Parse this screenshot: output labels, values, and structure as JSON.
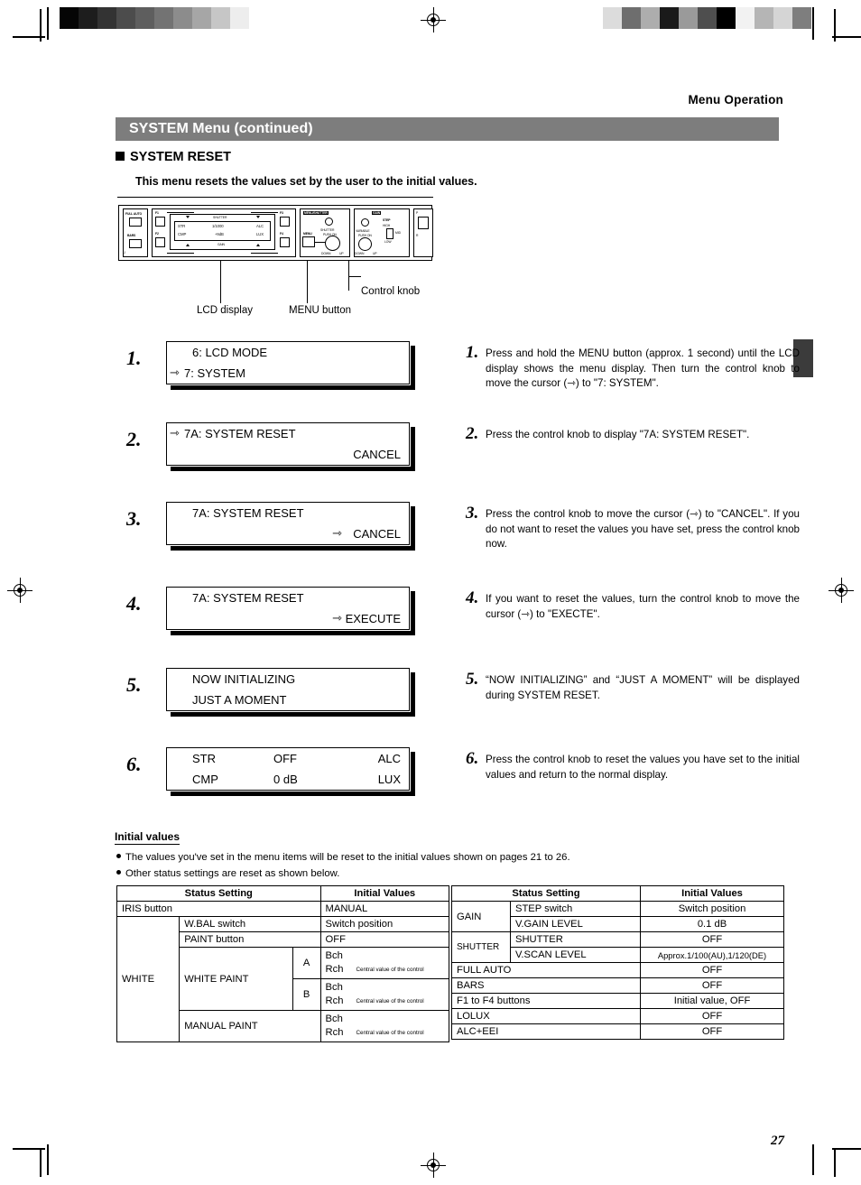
{
  "running_head": "Menu Operation",
  "title_bar": "SYSTEM Menu (continued)",
  "section_heading": "SYSTEM RESET",
  "section_subtitle": "This menu resets the values set by the user to the initial values.",
  "page_number": "27",
  "panel": {
    "buttons": {
      "full_auto": "FULL AUTO",
      "bars": "BARS",
      "f1": "F1",
      "f2": "F2",
      "f3": "F3",
      "f4": "F4",
      "menu": "MENU"
    },
    "lcd": {
      "top_label": "SHUTTER",
      "bottom_label": "GAIN",
      "row1": [
        "STR",
        "1/1000",
        "ALC"
      ],
      "row2": [
        "CMP",
        "+9dB",
        "LUX"
      ]
    },
    "menu_shutter_group": "MENU/SHUTTER",
    "gain_group": "GAIN",
    "shutter_label": "SHUTTER",
    "shutter_push_on": "PUSH ON",
    "variable_label": "VARIABLE",
    "variable_push_on": "PUSH ON",
    "step_label": "STEP",
    "step_high": "HIGH",
    "step_mid": "MID",
    "step_low": "LOW",
    "down": "DOWN",
    "up": "UP"
  },
  "callouts": {
    "lcd_display": "LCD display",
    "menu_button": "MENU button",
    "control_knob": "Control knob"
  },
  "steps": [
    {
      "num": "1.",
      "screen": {
        "row1": {
          "cursor": "",
          "left": "6: LCD MODE",
          "center": "",
          "right": ""
        },
        "row2": {
          "cursor": "⇾",
          "left": "7: SYSTEM",
          "center": "",
          "right": ""
        }
      },
      "instruction": "Press and hold the MENU button (approx. 1 second) until the LCD display shows the menu display. Then turn the control knob to move the cursor (⇾) to \"7: SYSTEM\"."
    },
    {
      "num": "2.",
      "screen": {
        "row1": {
          "cursor": "⇾",
          "left": "7A: SYSTEM RESET",
          "center": "",
          "right": ""
        },
        "row2": {
          "cursor": "",
          "left": "",
          "center": "",
          "right": "CANCEL"
        }
      },
      "instruction": "Press the control knob to display \"7A: SYSTEM RESET\"."
    },
    {
      "num": "3.",
      "screen": {
        "row1": {
          "cursor": "",
          "left": "7A: SYSTEM RESET",
          "center": "",
          "right": ""
        },
        "row2": {
          "cursor": "⇾",
          "left": "",
          "center": "",
          "right": "CANCEL"
        }
      },
      "instruction": "Press the control knob to move the cursor (⇾) to \"CANCEL\". If you do not want to reset the values you have set, press the control knob now."
    },
    {
      "num": "4.",
      "screen": {
        "row1": {
          "cursor": "",
          "left": "7A: SYSTEM RESET",
          "center": "",
          "right": ""
        },
        "row2": {
          "cursor": "⇾",
          "left": "",
          "center": "",
          "right": "EXECUTE"
        }
      },
      "instruction": "If you want to reset the values, turn the control knob to move the cursor (⇾) to \"EXECTE\"."
    },
    {
      "num": "5.",
      "screen": {
        "row1": {
          "cursor": "",
          "left": "NOW INITIALIZING",
          "center": "",
          "right": ""
        },
        "row2": {
          "cursor": "",
          "left": "JUST A MOMENT",
          "center": "",
          "right": ""
        }
      },
      "instruction": "“NOW INITIALIZING” and “JUST A MOMENT” will be displayed during SYSTEM RESET."
    },
    {
      "num": "6.",
      "screen": {
        "row1": {
          "cursor": "",
          "left": "STR",
          "center": "OFF",
          "right": "ALC"
        },
        "row2": {
          "cursor": "",
          "left": "CMP",
          "center": "0 dB",
          "right": "LUX"
        }
      },
      "instruction": "Press the control knob to reset the values you have set to the initial values and return to the normal display."
    }
  ],
  "initial_values": {
    "heading": "Initial values",
    "bullets": [
      "The values you've set in the menu items will be reset to the initial values shown on pages 21 to 26.",
      "Other status settings are reset as shown below."
    ],
    "headers": {
      "status_setting": "Status Setting",
      "initial_values": "Initial Values"
    },
    "left_rows": [
      {
        "group": "",
        "item": "IRIS button",
        "sub": "",
        "value": "MANUAL",
        "note": ""
      },
      {
        "group": "",
        "item": "W.BAL switch",
        "sub": "",
        "value": "Switch position",
        "note": ""
      },
      {
        "group": "",
        "item": "PAINT button",
        "sub": "",
        "value": "OFF",
        "note": ""
      },
      {
        "group": "WHITE",
        "item": "WHITE PAINT",
        "sub": "A",
        "value": "Bch\nRch",
        "note": "Central value of the control"
      },
      {
        "group": "WHITE",
        "item": "WHITE PAINT",
        "sub": "B",
        "value": "Bch\nRch",
        "note": "Central value of the control"
      },
      {
        "group": "WHITE",
        "item": "MANUAL PAINT",
        "sub": "",
        "value": "Bch\nRch",
        "note": "Central value of the control"
      }
    ],
    "left_labels": {
      "white_group": "WHITE",
      "white_paint": "WHITE PAINT",
      "manual_paint": "MANUAL PAINT",
      "sub_a": "A",
      "sub_b": "B",
      "bch": "Bch",
      "rch": "Rch",
      "central_note": "Central value of the control",
      "iris_button": "IRIS button",
      "iris_value": "MANUAL",
      "wbal_switch": "W.BAL switch",
      "wbal_value": "Switch position",
      "paint_button": "PAINT button",
      "paint_value": "OFF"
    },
    "right_rows": [
      {
        "group": "GAIN",
        "item": "STEP switch",
        "value": "Switch position"
      },
      {
        "group": "GAIN",
        "item": "V.GAIN LEVEL",
        "value": "0.1 dB"
      },
      {
        "group": "SHUTTER",
        "item": "SHUTTER",
        "value": "OFF"
      },
      {
        "group": "SHUTTER",
        "item": "V.SCAN LEVEL",
        "value": "Approx.1/100(AU),1/120(DE)"
      },
      {
        "group": "",
        "item": "FULL AUTO",
        "value": "OFF"
      },
      {
        "group": "",
        "item": "BARS",
        "value": "OFF"
      },
      {
        "group": "",
        "item": "F1 to F4 buttons",
        "value": "Initial value, OFF"
      },
      {
        "group": "",
        "item": "LOLUX",
        "value": "OFF"
      },
      {
        "group": "",
        "item": "ALC+EEI",
        "value": "OFF"
      }
    ]
  },
  "colors": {
    "title_bar_bg": "#7d7d7d",
    "edge_tab": "#3b3b3b",
    "ink": "#000000"
  },
  "gray_strip_left": [
    "#050505",
    "#1d1d1d",
    "#333333",
    "#4c4c4c",
    "#5e5e5e",
    "#737373",
    "#8c8c8c",
    "#a6a6a6",
    "#c6c6c6",
    "#ededed",
    "#ffffff"
  ],
  "gray_strip_right": [
    "#dcdcdc",
    "#6e6e6e",
    "#adadad",
    "#1a1a1a",
    "#9a9a9a",
    "#4e4e4e",
    "#000000",
    "#f2f2f2",
    "#b5b5b5",
    "#d5d5d5",
    "#7e7e7e"
  ]
}
